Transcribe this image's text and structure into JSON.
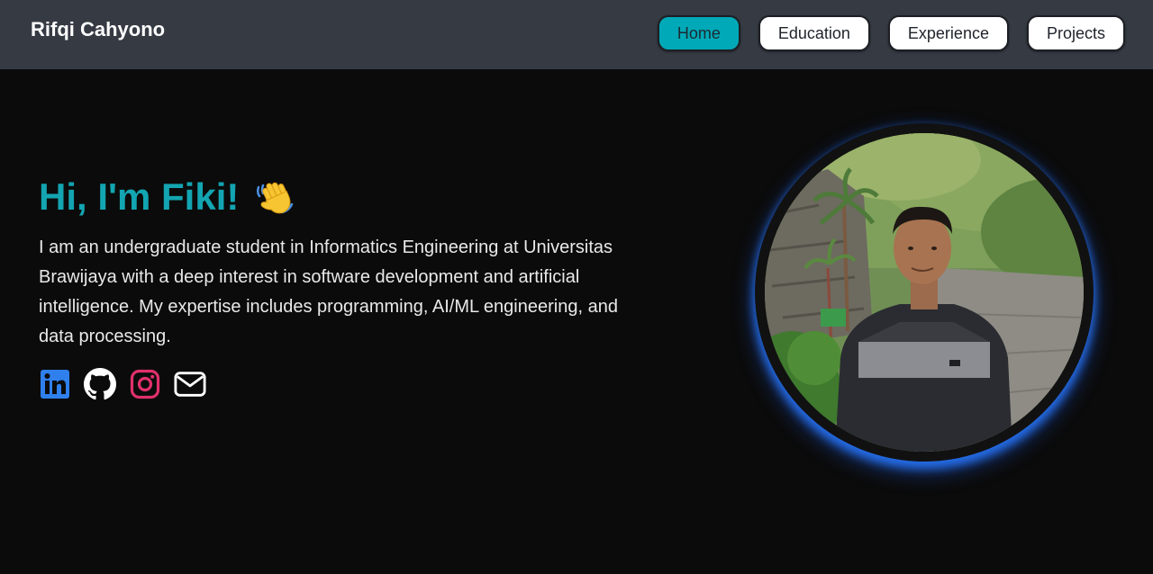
{
  "header": {
    "brand": "Rifqi Cahyono",
    "nav": [
      {
        "label": "Home",
        "active": true
      },
      {
        "label": "Education",
        "active": false
      },
      {
        "label": "Experience",
        "active": false
      },
      {
        "label": "Projects",
        "active": false
      }
    ]
  },
  "hero": {
    "greeting": "Hi, I'm Fiki!",
    "greeting_emoji": "waving-hand-icon",
    "bio": "I am an undergraduate student in Informatics Engineering at Universitas Brawijaya with a deep interest in software development and artificial intelligence. My expertise includes programming, AI/ML engineering, and data processing.",
    "socials": [
      {
        "icon": "linkedin-icon",
        "color": "#2f80ed"
      },
      {
        "icon": "github-icon",
        "color": "#ffffff"
      },
      {
        "icon": "instagram-icon",
        "color": "#e1306c"
      },
      {
        "icon": "email-icon",
        "color": "#ffffff"
      }
    ],
    "profile_photo": "profile-photo"
  },
  "colors": {
    "navbar_bg": "#353a43",
    "page_bg": "#0b0b0b",
    "accent": "#13a5b1",
    "active_nav": "#00a9b7",
    "photo_glow": "#2878ff"
  }
}
